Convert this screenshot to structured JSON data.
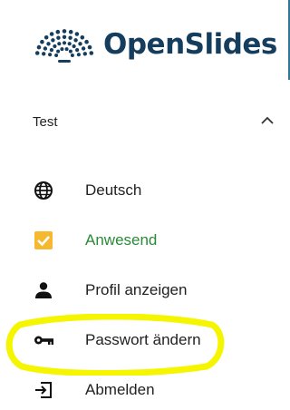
{
  "brand": {
    "name": "OpenSlides",
    "logo_icon": "openslides-logo-icon",
    "color": "#153d5d"
  },
  "user": {
    "name": "Test",
    "expand_icon": "chevron-up-icon"
  },
  "menu": [
    {
      "label": "Deutsch",
      "icon": "globe-icon"
    },
    {
      "label": "Anwesend",
      "icon": "checkbox-checked-icon",
      "active": true,
      "color": "#2a8a35",
      "checkbox_color": "#f5b82e"
    },
    {
      "label": "Profil anzeigen",
      "icon": "person-icon"
    },
    {
      "label": "Passwort ändern",
      "icon": "key-icon"
    },
    {
      "label": "Abmelden",
      "icon": "logout-icon"
    }
  ],
  "annotation": {
    "highlight_color": "#f5f500"
  }
}
